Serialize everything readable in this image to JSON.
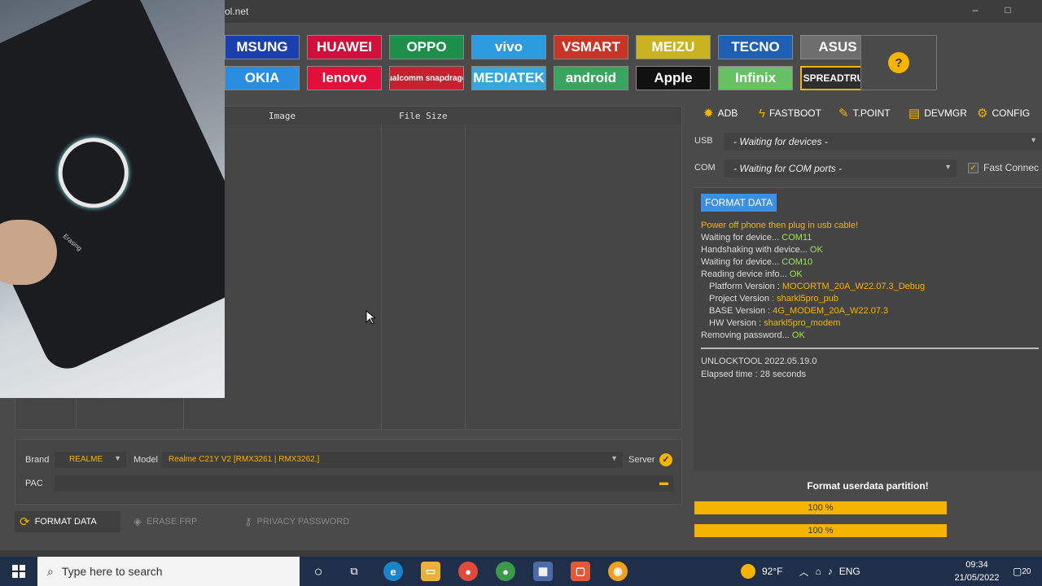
{
  "window": {
    "title_fragment": "ol.net",
    "controls": [
      "–",
      "□"
    ]
  },
  "brands_row1": [
    {
      "label": "MSUNG",
      "bg": "#1c3fae"
    },
    {
      "label": "HUAWEI",
      "bg": "#d0103a"
    },
    {
      "label": "OPPO",
      "bg": "#1d8f4a"
    },
    {
      "label": "vivo",
      "bg": "#2d9be0"
    },
    {
      "label": "VSMART",
      "bg": "#c73527"
    },
    {
      "label": "MEIZU",
      "bg": "#c9b320"
    },
    {
      "label": "TECNO",
      "bg": "#1f5fb4"
    },
    {
      "label": "ASUS",
      "bg": "#6e6e6e"
    }
  ],
  "brands_row2": [
    {
      "label": "OKIA",
      "bg": "#2a8de0"
    },
    {
      "label": "lenovo",
      "bg": "#e0103a"
    },
    {
      "label": "Qualcomm snapdragon",
      "bg": "#c7202f"
    },
    {
      "label": "MEDIATEK",
      "bg": "#36a7d8"
    },
    {
      "label": "android",
      "bg": "#3aa55e"
    },
    {
      "label": "Apple",
      "bg": "#111111"
    },
    {
      "label": "Infinix",
      "bg": "#67c063"
    },
    {
      "label": "SPREADTRUM",
      "bg": "#2e2e2e"
    }
  ],
  "help": {
    "icon": "?"
  },
  "file_table": {
    "columns": [
      "Image",
      "File Size"
    ]
  },
  "device": {
    "brand_label": "Brand",
    "brand_value": "REALME",
    "model_label": "Model",
    "model_value": "Realme C21Y V2 [RMX3261 | RMX3262.]",
    "server_label": "Server",
    "pac_label": "PAC"
  },
  "actions": {
    "format": "FORMAT DATA",
    "erase_frp": "ERASE FRP",
    "privacy": "PRIVACY PASSWORD"
  },
  "tabs": [
    {
      "label": "ADB",
      "icon": "bug-icon"
    },
    {
      "label": "FASTBOOT",
      "icon": "lightning-icon"
    },
    {
      "label": "T.POINT",
      "icon": "pin-icon"
    },
    {
      "label": "DEVMGR",
      "icon": "device-manager-icon"
    },
    {
      "label": "CONFIG",
      "icon": "gear-icon"
    }
  ],
  "connection": {
    "usb_label": "USB",
    "usb_value": "- Waiting for devices -",
    "com_label": "COM",
    "com_value": "- Waiting for COM ports -",
    "fast_connect": "Fast Connec"
  },
  "log": {
    "header_button": "FORMAT DATA",
    "line1": "Power off phone then plug in usb cable!",
    "l2a": "Waiting for device... ",
    "l2b": "COM11",
    "l3a": "Handshaking with device... ",
    "l3b": "OK",
    "l4a": "Waiting for device... ",
    "l4b": "COM10",
    "l5a": "Reading device info... ",
    "l5b": "OK",
    "l6a": "Platform Version : ",
    "l6b": "MOCORTM_20A_W22.07.3_Debug",
    "l7a": "Project Version : ",
    "l7b": "sharkl5pro_pub",
    "l8a": "BASE Version : ",
    "l8b": "4G_MODEM_20A_W22.07.3",
    "l9a": "HW Version : ",
    "l9b": "sharkl5pro_modem",
    "l10a": "Removing password... ",
    "l10b": "OK",
    "version_label": "UNLOCKTOOL",
    "version_value": "2022.05.19.0",
    "elapsed": "Elapsed time : 28 seconds"
  },
  "status": {
    "message": "Format userdata partition!",
    "progress1_percent": 100,
    "progress1_text": "100 %",
    "progress2_percent": 100,
    "progress2_text": "100 %"
  },
  "taskbar": {
    "search_placeholder": "Type here to search",
    "weather": "92°F",
    "language": "ENG",
    "time": "09:34",
    "date": "21/05/2022",
    "notifications": "20"
  },
  "photo": {
    "screen_text": "Erasing"
  }
}
